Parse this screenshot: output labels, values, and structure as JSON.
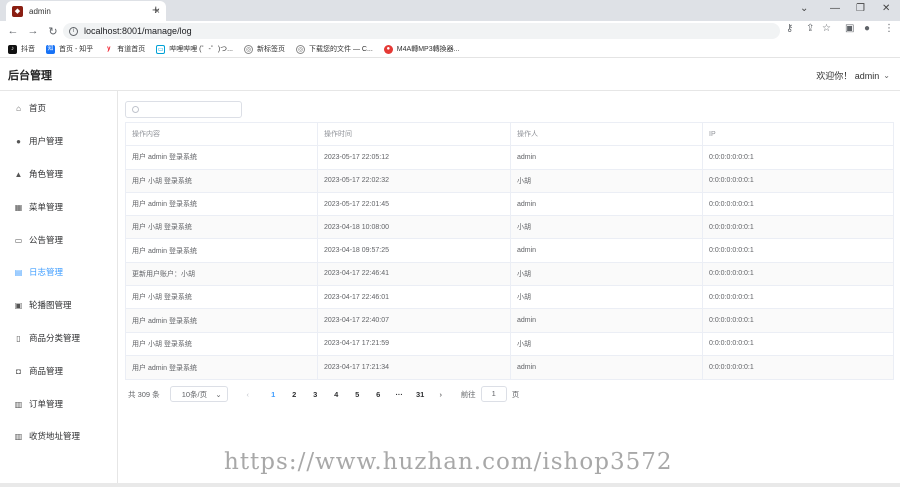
{
  "browser": {
    "tab_title": "admin",
    "url": "localhost:8001/manage/log",
    "bookmarks": [
      "抖音",
      "首页 - 知乎",
      "有道首页",
      "哔哩哔哩 (゜-゜)つ...",
      "新标签页",
      "下载您的文件 — C...",
      "M4A轉MP3轉換器..."
    ]
  },
  "header": {
    "title": "后台管理",
    "welcome": "欢迎你！ admin"
  },
  "sidebar": {
    "items": [
      {
        "label": "首页",
        "icon": "home-icon"
      },
      {
        "label": "用户管理",
        "icon": "user-icon"
      },
      {
        "label": "角色管理",
        "icon": "role-icon"
      },
      {
        "label": "菜单管理",
        "icon": "menu-icon"
      },
      {
        "label": "公告管理",
        "icon": "notice-icon"
      },
      {
        "label": "日志管理",
        "icon": "log-icon"
      },
      {
        "label": "轮播图管理",
        "icon": "image-icon"
      },
      {
        "label": "商品分类管理",
        "icon": "category-icon"
      },
      {
        "label": "商品管理",
        "icon": "goods-icon"
      },
      {
        "label": "订单管理",
        "icon": "order-icon"
      },
      {
        "label": "收货地址管理",
        "icon": "address-icon"
      }
    ],
    "active": "日志管理"
  },
  "search": {
    "placeholder": "",
    "value": ""
  },
  "table": {
    "headers": [
      "操作内容",
      "操作时间",
      "操作人",
      "IP"
    ],
    "rows": [
      [
        "用户 admin 登录系统",
        "2023-05-17 22:05:12",
        "admin",
        "0:0:0:0:0:0:0:1"
      ],
      [
        "用户 小胡 登录系统",
        "2023-05-17 22:02:32",
        "小胡",
        "0:0:0:0:0:0:0:1"
      ],
      [
        "用户 admin 登录系统",
        "2023-05-17 22:01:45",
        "admin",
        "0:0:0:0:0:0:0:1"
      ],
      [
        "用户 小胡 登录系统",
        "2023-04-18 10:08:00",
        "小胡",
        "0:0:0:0:0:0:0:1"
      ],
      [
        "用户 admin 登录系统",
        "2023-04-18 09:57:25",
        "admin",
        "0:0:0:0:0:0:0:1"
      ],
      [
        "更新用户账户：小胡",
        "2023-04-17 22:46:41",
        "小胡",
        "0:0:0:0:0:0:0:1"
      ],
      [
        "用户 小胡 登录系统",
        "2023-04-17 22:46:01",
        "小胡",
        "0:0:0:0:0:0:0:1"
      ],
      [
        "用户 admin 登录系统",
        "2023-04-17 22:40:07",
        "admin",
        "0:0:0:0:0:0:0:1"
      ],
      [
        "用户 小胡 登录系统",
        "2023-04-17 17:21:59",
        "小胡",
        "0:0:0:0:0:0:0:1"
      ],
      [
        "用户 admin 登录系统",
        "2023-04-17 17:21:34",
        "admin",
        "0:0:0:0:0:0:0:1"
      ]
    ]
  },
  "pagination": {
    "total": "共 309 条",
    "page_size": "10条/页",
    "pages": [
      "1",
      "2",
      "3",
      "4",
      "5",
      "6",
      "···",
      "31"
    ],
    "current": "1",
    "goto_label": "前往",
    "goto_value": "1",
    "goto_suffix": "页"
  },
  "watermark": "https://www.huzhan.com/ishop3572",
  "colors": {
    "accent": "#409eff",
    "border": "#ebeef5",
    "stripe": "#fafafa"
  }
}
